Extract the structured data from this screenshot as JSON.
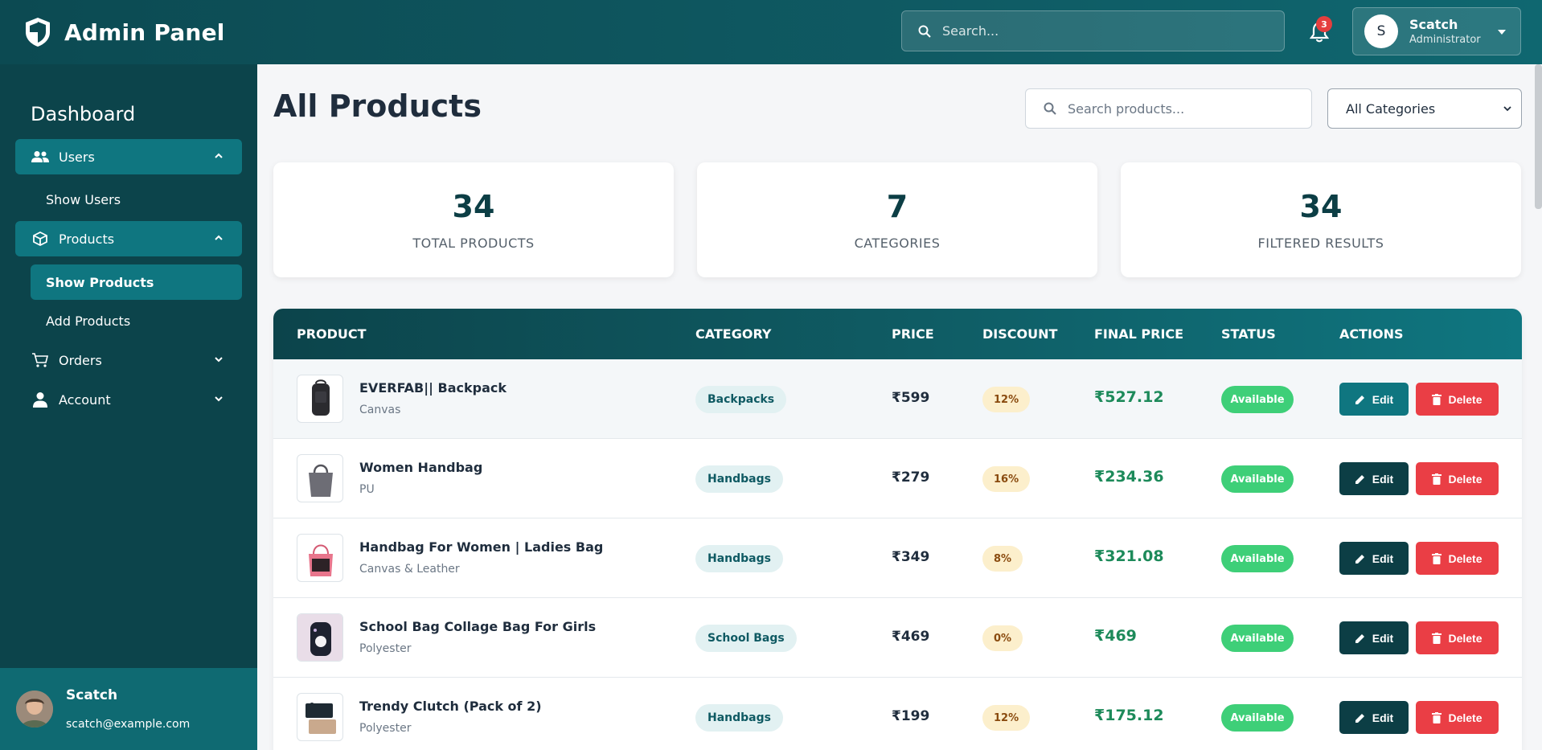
{
  "header": {
    "brand": "Admin Panel",
    "search_placeholder": "Search...",
    "notification_count": "3",
    "user": {
      "initial": "S",
      "name": "Scatch",
      "role": "Administrator"
    }
  },
  "sidebar": {
    "heading": "Dashboard",
    "groups": [
      {
        "label": "Users",
        "icon": "users-icon",
        "expanded": true,
        "items": [
          "Show Users"
        ]
      },
      {
        "label": "Products",
        "icon": "box-icon",
        "expanded": true,
        "items": [
          "Show Products",
          "Add Products"
        ]
      },
      {
        "label": "Orders",
        "icon": "cart-icon",
        "expanded": false
      },
      {
        "label": "Account",
        "icon": "user-icon",
        "expanded": false
      }
    ],
    "footer_user": {
      "name": "Scatch",
      "email": "scatch@example.com"
    }
  },
  "main": {
    "title": "All Products",
    "search_placeholder": "Search products...",
    "category_select": "All Categories",
    "stats": [
      {
        "value": "34",
        "label": "TOTAL PRODUCTS"
      },
      {
        "value": "7",
        "label": "CATEGORIES"
      },
      {
        "value": "34",
        "label": "FILTERED RESULTS"
      }
    ],
    "table": {
      "columns": [
        "PRODUCT",
        "CATEGORY",
        "PRICE",
        "DISCOUNT",
        "FINAL PRICE",
        "STATUS",
        "ACTIONS"
      ],
      "edit_label": "Edit",
      "delete_label": "Delete",
      "rows": [
        {
          "name": "EVERFAB|| Backpack",
          "material": "Canvas",
          "category": "Backpacks",
          "price": "₹599",
          "discount": "12%",
          "final_price": "₹527.12",
          "status": "Available"
        },
        {
          "name": "Women Handbag",
          "material": "PU",
          "category": "Handbags",
          "price": "₹279",
          "discount": "16%",
          "final_price": "₹234.36",
          "status": "Available"
        },
        {
          "name": "Handbag For Women | Ladies Bag",
          "material": "Canvas & Leather",
          "category": "Handbags",
          "price": "₹349",
          "discount": "8%",
          "final_price": "₹321.08",
          "status": "Available"
        },
        {
          "name": "School Bag Collage Bag For Girls",
          "material": "Polyester",
          "category": "School Bags",
          "price": "₹469",
          "discount": "0%",
          "final_price": "₹469",
          "status": "Available"
        },
        {
          "name": "Trendy Clutch (Pack of 2)",
          "material": "Polyester",
          "category": "Handbags",
          "price": "₹199",
          "discount": "12%",
          "final_price": "₹175.12",
          "status": "Available"
        }
      ]
    }
  },
  "colors": {
    "header_bg": "#0c4a52",
    "sidebar_bg": "#0c444b",
    "accent": "#0f7680",
    "danger": "#ea3e45",
    "success": "#3ecf78",
    "final_price": "#1d8a5a"
  }
}
